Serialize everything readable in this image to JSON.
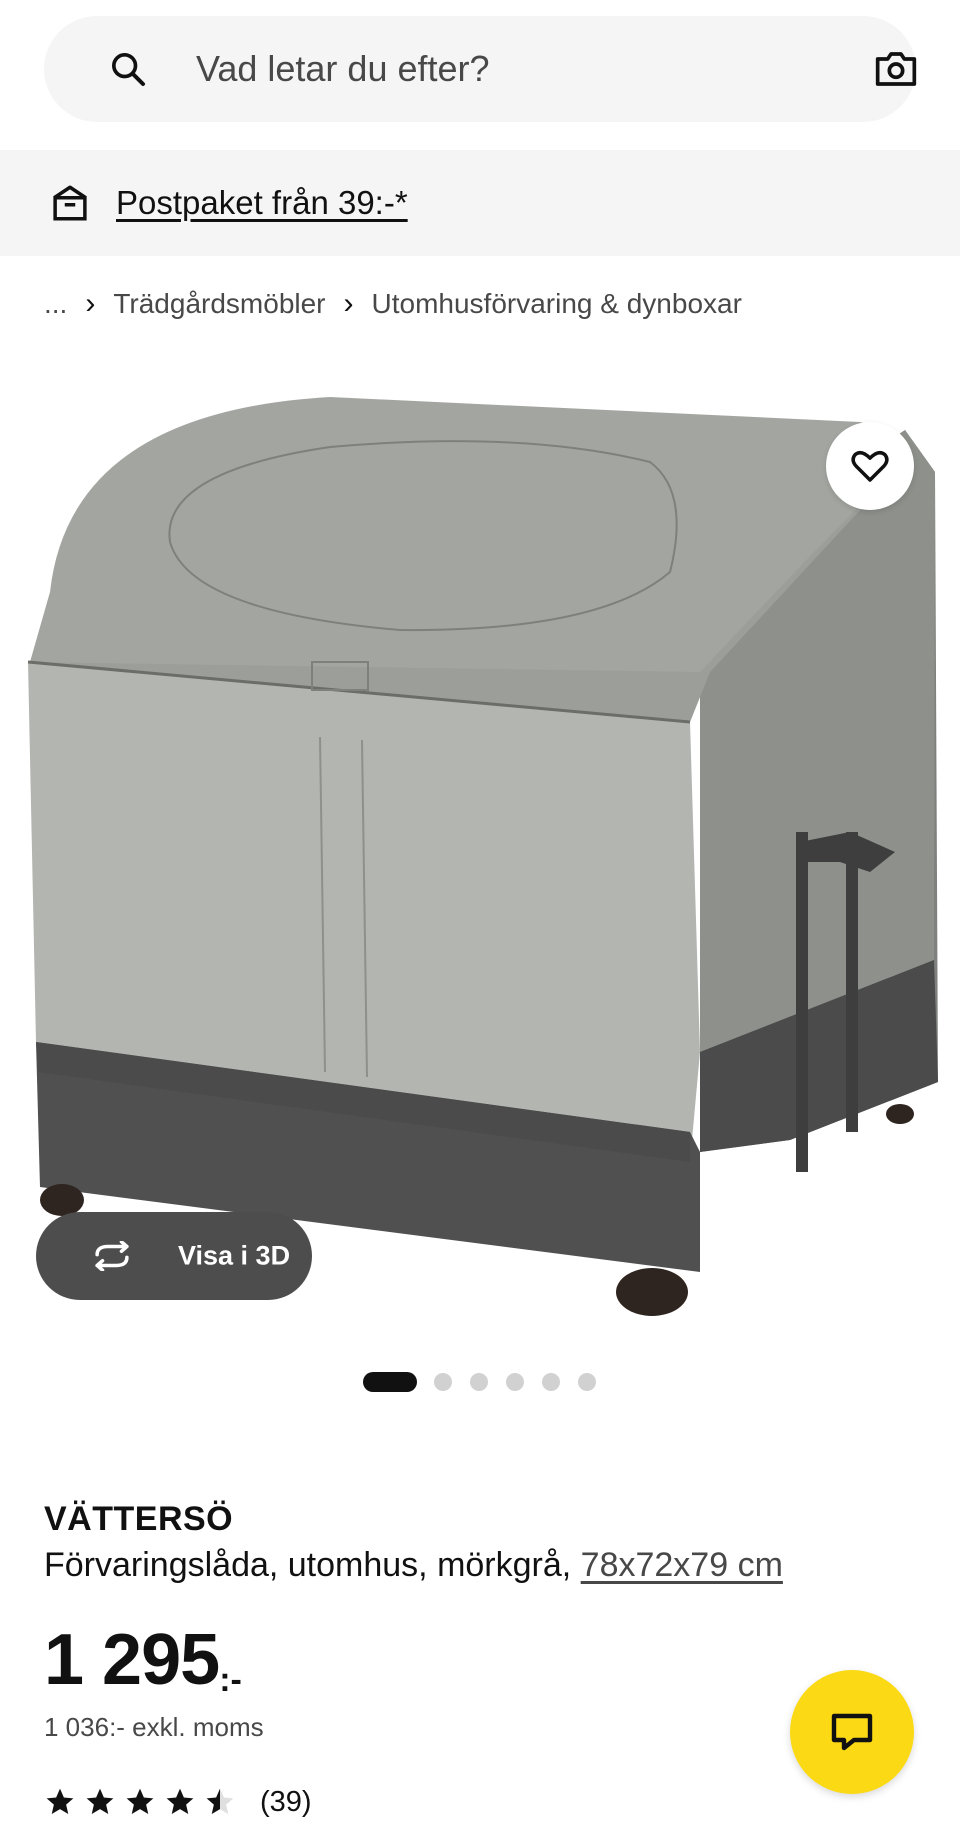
{
  "search": {
    "placeholder": "Vad letar du efter?",
    "icon": "search-icon",
    "camera_icon": "camera-icon"
  },
  "promo": {
    "icon": "parcel-icon",
    "text": "Postpaket från 39:-*"
  },
  "breadcrumb": {
    "ellipsis": "...",
    "items": [
      "Trädgårdsmöbler",
      "Utomhusförvaring & dynboxar"
    ]
  },
  "gallery": {
    "view3d_label": "Visa i 3D",
    "slide_count": 6,
    "active_slide": 1
  },
  "product": {
    "name": "VÄTTERSÖ",
    "description": "Förvaringslåda, utomhus, mörkgrå, ",
    "dimensions": "78x72x79 cm",
    "price_amount": "1 295",
    "price_suffix": ":-",
    "price_ex_vat": "1 036:- exkl. moms",
    "rating": 4.5,
    "review_count": "(39)"
  },
  "colors": {
    "accent_yellow": "#fbd914",
    "dark_button": "#4d4d4d",
    "light_gray_bg": "#f5f5f5"
  }
}
